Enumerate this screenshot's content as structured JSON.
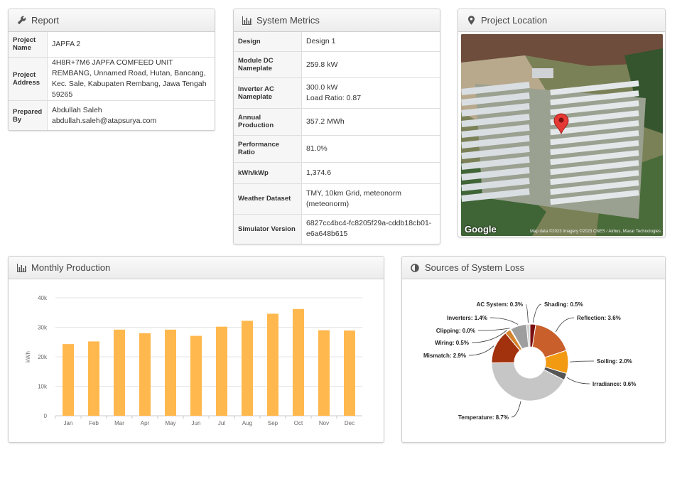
{
  "report": {
    "title": "Report",
    "rows": [
      {
        "label": "Project Name",
        "value": "JAPFA 2"
      },
      {
        "label": "Project Address",
        "value": "4H8R+7M6 JAPFA COMFEED UNIT REMBANG, Unnamed Road, Hutan, Bancang, Kec. Sale, Kabupaten Rembang, Jawa Tengah 59265"
      },
      {
        "label": "Prepared By",
        "value": "Abdullah Saleh",
        "value2": "abdullah.saleh@atapsurya.com"
      }
    ]
  },
  "metrics": {
    "title": "System Metrics",
    "rows": [
      {
        "label": "Design",
        "value": "Design 1"
      },
      {
        "label": "Module DC Nameplate",
        "value": "259.8 kW"
      },
      {
        "label": "Inverter AC Nameplate",
        "value": "300.0 kW",
        "value2": "Load Ratio: 0.87"
      },
      {
        "label": "Annual Production",
        "value": "357.2 MWh"
      },
      {
        "label": "Performance Ratio",
        "value": "81.0%"
      },
      {
        "label": "kWh/kWp",
        "value": "1,374.6"
      },
      {
        "label": "Weather Dataset",
        "value": "TMY, 10km Grid, meteonorm (meteonorm)"
      },
      {
        "label": "Simulator Version",
        "value": "6827cc4bc4-fc8205f29a-cddb18cb01-e6a648b615"
      }
    ]
  },
  "location": {
    "title": "Project Location",
    "google": "Google",
    "attribution": "Map data ©2023 Imagery ©2023 CNES / Airbus, Maxar Technologies"
  },
  "monthly": {
    "title": "Monthly Production"
  },
  "losses": {
    "title": "Sources of System Loss"
  },
  "chart_data": [
    {
      "type": "bar",
      "categories": [
        "Jan",
        "Feb",
        "Mar",
        "Apr",
        "May",
        "Jun",
        "Jul",
        "Aug",
        "Sep",
        "Oct",
        "Nov",
        "Dec"
      ],
      "values": [
        24300,
        25200,
        29200,
        28000,
        29200,
        27100,
        30200,
        32200,
        34600,
        36200,
        29000,
        28900
      ],
      "title": "",
      "xlabel": "",
      "ylabel": "kWh",
      "ylim": [
        0,
        40000
      ],
      "yticks": [
        "0",
        "10k",
        "20k",
        "30k",
        "40k"
      ],
      "color": "#ffb84d",
      "grid": true
    },
    {
      "type": "pie",
      "slices": [
        {
          "label": "Shading: 0.5%",
          "value": 0.5,
          "color": "#7a0f0f"
        },
        {
          "label": "Reflection: 3.6%",
          "value": 3.6,
          "color": "#c95f2a"
        },
        {
          "label": "Soiling: 2.0%",
          "value": 2.0,
          "color": "#f29a12"
        },
        {
          "label": "Irradiance: 0.6%",
          "value": 0.6,
          "color": "#555555"
        },
        {
          "label": "Temperature: 8.7%",
          "value": 8.7,
          "color": "#c6c6c6"
        },
        {
          "label": "Mismatch: 2.9%",
          "value": 2.9,
          "color": "#a2310d"
        },
        {
          "label": "Wiring: 0.5%",
          "value": 0.5,
          "color": "#d4842f"
        },
        {
          "label": "Clipping: 0.0%",
          "value": 0.0,
          "color": "#e0b070"
        },
        {
          "label": "Inverters: 1.4%",
          "value": 1.4,
          "color": "#9e9e9e"
        },
        {
          "label": "AC System: 0.3%",
          "value": 0.3,
          "color": "#d0d0d0"
        }
      ]
    }
  ]
}
